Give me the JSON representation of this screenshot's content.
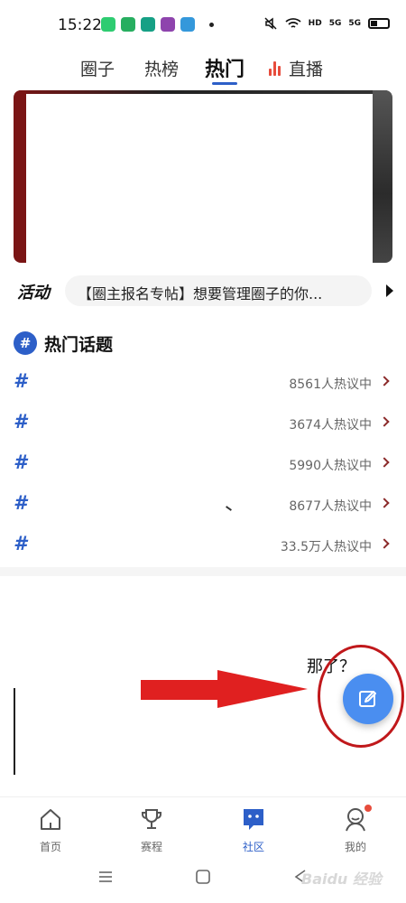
{
  "status_bar": {
    "time": "15:22",
    "hd_label": "HD",
    "sig1": "5G",
    "sig2": "5G",
    "app_colors": [
      "#2ecc71",
      "#27ae60",
      "#16a085",
      "#8e44ad",
      "#3498db"
    ]
  },
  "top_tabs": {
    "items": [
      {
        "label": "圈子"
      },
      {
        "label": "热榜"
      },
      {
        "label": "热门"
      },
      {
        "label": "直播"
      }
    ],
    "active": "热门"
  },
  "activity": {
    "label": "活动",
    "text": "【圈主报名专帖】想要管理圈子的你..."
  },
  "hot_topics": {
    "title": "热门话题",
    "icon_text": "#",
    "items": [
      {
        "hash": "#",
        "count": "8561人热议中"
      },
      {
        "hash": "#",
        "count": "3674人热议中"
      },
      {
        "hash": "#",
        "count": "5990人热议中"
      },
      {
        "hash": "#",
        "count": "8677人热议中"
      },
      {
        "hash": "#",
        "count": "33.5万人热议中"
      }
    ]
  },
  "partial_text": "那了？",
  "bottom_nav": {
    "items": [
      {
        "label": "首页",
        "icon": "home-icon"
      },
      {
        "label": "赛程",
        "icon": "trophy-icon"
      },
      {
        "label": "社区",
        "icon": "community-icon"
      },
      {
        "label": "我的",
        "icon": "profile-icon"
      }
    ],
    "active": "社区"
  },
  "watermark": "Baidu 经验",
  "colors": {
    "accent": "#2d5fc8",
    "fab": "#4a8ef0",
    "annotation_red": "#e02020"
  }
}
